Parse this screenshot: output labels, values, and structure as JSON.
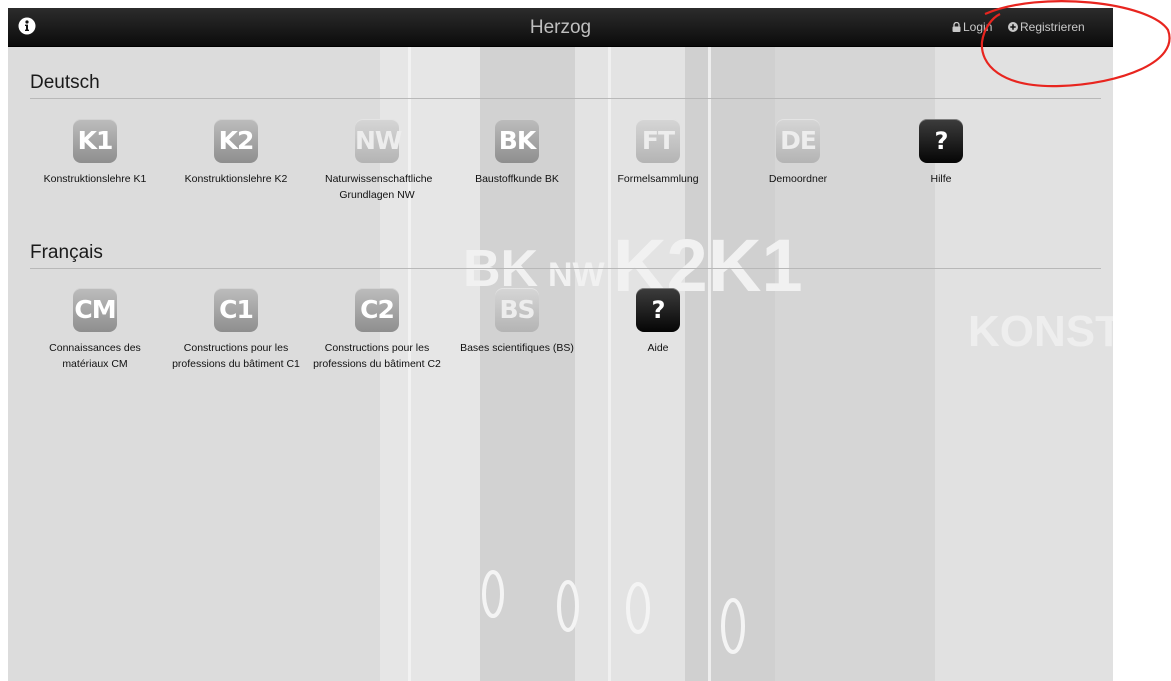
{
  "header": {
    "title": "Herzog",
    "login_label": "Login",
    "register_label": "Registrieren",
    "icons": {
      "info": "info-circle-icon",
      "login": "lock-icon",
      "register": "plus-circle-icon"
    }
  },
  "sections": [
    {
      "title": "Deutsch",
      "tiles": [
        {
          "icon_text": "K1",
          "label": "Konstruktionslehre K1"
        },
        {
          "icon_text": "K2",
          "label": "Konstruktionslehre K2"
        },
        {
          "icon_text": "NW",
          "label": "Naturwissenschaftliche Grundlagen NW"
        },
        {
          "icon_text": "BK",
          "label": "Baustoffkunde BK"
        },
        {
          "icon_text": "FT",
          "label": "Formelsammlung"
        },
        {
          "icon_text": "DE",
          "label": "Demoordner"
        },
        {
          "icon_text": "?",
          "label": "Hilfe"
        }
      ]
    },
    {
      "title": "Français",
      "tiles": [
        {
          "icon_text": "CM",
          "label": "Connaissances des matériaux CM"
        },
        {
          "icon_text": "C1",
          "label": "Constructions pour les professions du bâtiment C1"
        },
        {
          "icon_text": "C2",
          "label": "Constructions pour les professions du bâtiment C2"
        },
        {
          "icon_text": "BS",
          "label": "Bases scientifiques (BS)"
        },
        {
          "icon_text": "?",
          "label": "Aide"
        }
      ]
    }
  ],
  "background_art": {
    "binder_labels": [
      "BK",
      "NW",
      "K2",
      "K1",
      "KONST"
    ]
  },
  "colors": {
    "topbar": "#111111",
    "annotation": "#e8251f",
    "page_bg": "#dcdcdc"
  }
}
